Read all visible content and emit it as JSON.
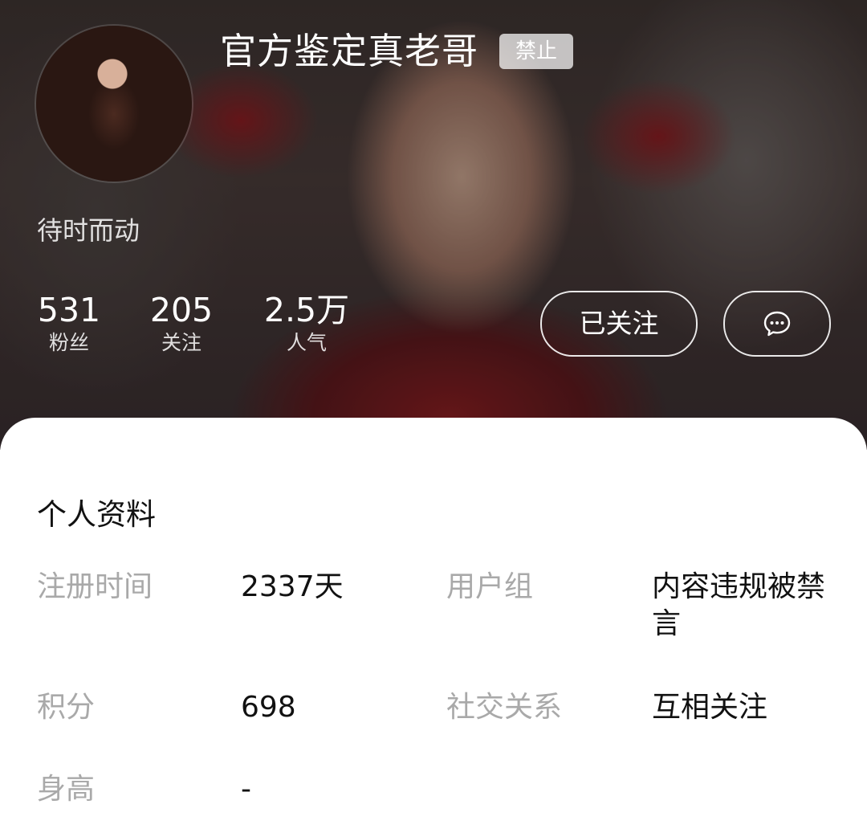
{
  "profile": {
    "username": "官方鉴定真老哥",
    "badge": "禁止",
    "signature": "待时而动",
    "avatar_icon": "avatar-image"
  },
  "stats": [
    {
      "value": "531",
      "label": "粉丝"
    },
    {
      "value": "205",
      "label": "关注"
    },
    {
      "value": "2.5万",
      "label": "人气"
    }
  ],
  "actions": {
    "follow_label": "已关注",
    "message_icon": "chat-bubble-icon"
  },
  "info": {
    "title": "个人资料",
    "fields": [
      {
        "label": "注册时间",
        "value": "2337天"
      },
      {
        "label": "用户组",
        "value": "内容违规被禁言"
      },
      {
        "label": "积分",
        "value": "698"
      },
      {
        "label": "社交关系",
        "value": "互相关注"
      },
      {
        "label": "身高",
        "value": "-"
      }
    ]
  },
  "colors": {
    "label_gray": "#a9a9a9",
    "text_dark": "#111111",
    "badge_bg": "rgba(255,255,255,0.72)"
  }
}
